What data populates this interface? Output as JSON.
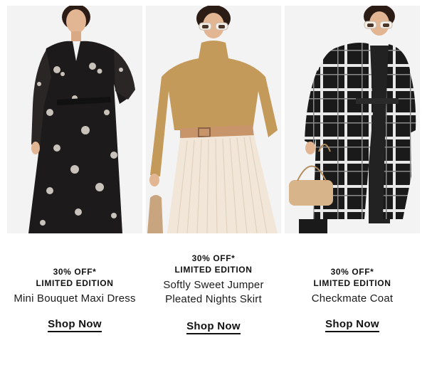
{
  "products": [
    {
      "promo_line1": "30% OFF*",
      "promo_line2": "LIMITED EDITION",
      "name_line1": "Mini Bouquet Maxi Dress",
      "name_line2": "",
      "cta": "Shop Now"
    },
    {
      "promo_line1": "30% OFF*",
      "promo_line2": "LIMITED EDITION",
      "name_line1": "Softly Sweet Jumper",
      "name_line2": "Pleated Nights Skirt",
      "cta": "Shop Now"
    },
    {
      "promo_line1": "30% OFF*",
      "promo_line2": "LIMITED EDITION",
      "name_line1": "Checkmate Coat",
      "name_line2": "",
      "cta": "Shop Now"
    }
  ],
  "colors": {
    "background": "#ffffff",
    "photo_bg": "#f3f3f3",
    "text": "#111111",
    "dress": "#1c1a1a",
    "jumper": "#c49a5a",
    "skirt": "#f1e6d8",
    "belt": "#c8956b",
    "coat": "#1a1a1a",
    "bag": "#d8b48a"
  }
}
